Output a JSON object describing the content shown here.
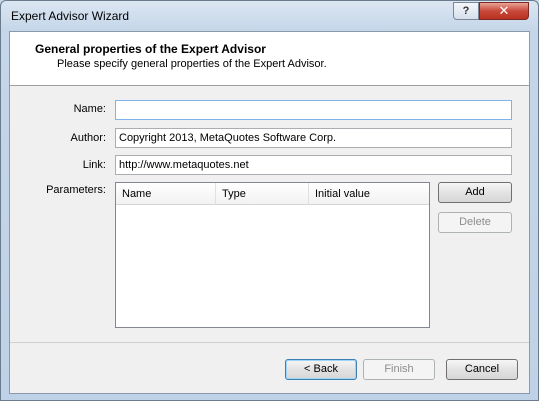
{
  "window": {
    "title": "Expert Advisor Wizard",
    "help_glyph": "?",
    "close_glyph": "✕"
  },
  "header": {
    "title": "General properties of the Expert Advisor",
    "subtitle": "Please specify general properties of the Expert Advisor."
  },
  "form": {
    "name_label": "Name:",
    "name_value": "",
    "author_label": "Author:",
    "author_value": "Copyright 2013, MetaQuotes Software Corp.",
    "link_label": "Link:",
    "link_value": "http://www.metaquotes.net",
    "parameters_label": "Parameters:"
  },
  "parameters_table": {
    "columns": [
      "Name",
      "Type",
      "Initial value"
    ],
    "rows": []
  },
  "side_buttons": {
    "add": "Add",
    "delete": "Delete"
  },
  "footer": {
    "back": "< Back",
    "finish": "Finish",
    "cancel": "Cancel"
  }
}
